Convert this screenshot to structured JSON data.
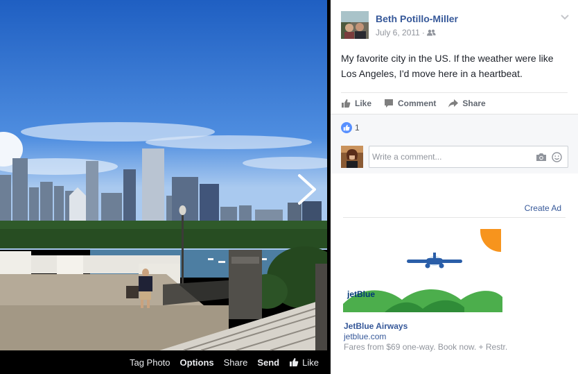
{
  "photo": {
    "actions": {
      "tag_photo": "Tag Photo",
      "options": "Options",
      "share": "Share",
      "send": "Send",
      "like": "Like"
    }
  },
  "post": {
    "author": "Beth Potillo-Miller",
    "date": "July 6, 2011",
    "separator": "·",
    "audience_icon": "friends-icon",
    "text": "My favorite city in the US. If the weather were like Los Angeles, I'd move here in a heartbeat.",
    "actions": {
      "like": "Like",
      "comment": "Comment",
      "share": "Share"
    },
    "reactions": {
      "count": "1",
      "type": "like"
    },
    "comment_placeholder": "Write a comment..."
  },
  "ad": {
    "create_ad": "Create Ad",
    "brand_logo": "jetBlue",
    "title": "JetBlue Airways",
    "url": "jetblue.com",
    "description": "Fares from $69 one-way. Book now. + Restr."
  },
  "colors": {
    "link": "#365899",
    "meta": "#90949c",
    "like_blue": "#5890ff",
    "ad_green": "#4cae4c",
    "ad_sun": "#f7941d",
    "ad_brand": "#003876"
  }
}
